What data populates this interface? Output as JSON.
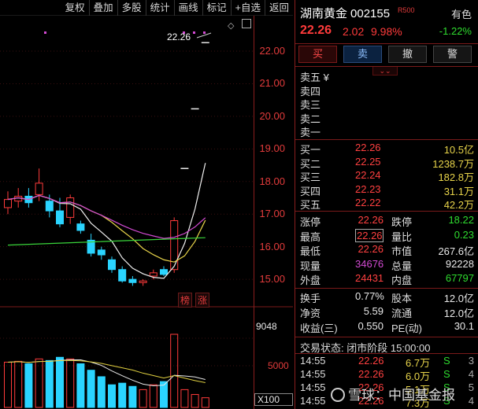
{
  "toolbar": {
    "items": [
      "复权",
      "叠加",
      "多股",
      "统计",
      "画线",
      "标记",
      "+自选",
      "返回"
    ]
  },
  "chart": {
    "price_axis": [
      "22.00",
      "21.00",
      "20.00",
      "19.00",
      "18.00",
      "17.00",
      "16.00",
      "15.00"
    ],
    "last_price_label": "22.26",
    "tag_bang": "榜",
    "tag_zhang": "涨",
    "volume_top": "9048",
    "volume_mid": "5000",
    "volume_unit": "X100"
  },
  "chart_data": {
    "type": "candlestick",
    "ylim": [
      14.4,
      22.7
    ],
    "candles": [
      {
        "o": 17.2,
        "c": 17.45,
        "h": 17.7,
        "l": 17.0
      },
      {
        "o": 17.4,
        "c": 17.55,
        "h": 17.8,
        "l": 17.2
      },
      {
        "o": 17.55,
        "c": 17.35,
        "h": 17.8,
        "l": 17.2
      },
      {
        "o": 17.6,
        "c": 17.95,
        "h": 18.4,
        "l": 17.4
      },
      {
        "o": 17.4,
        "c": 17.1,
        "h": 17.6,
        "l": 16.9
      },
      {
        "o": 17.1,
        "c": 16.7,
        "h": 17.5,
        "l": 16.6
      },
      {
        "o": 16.9,
        "c": 17.5,
        "h": 17.6,
        "l": 16.7
      },
      {
        "o": 16.7,
        "c": 16.5,
        "h": 16.8,
        "l": 16.4
      },
      {
        "o": 16.2,
        "c": 15.8,
        "h": 16.4,
        "l": 15.7
      },
      {
        "o": 15.9,
        "c": 15.75,
        "h": 16.0,
        "l": 15.6
      },
      {
        "o": 15.6,
        "c": 15.3,
        "h": 15.7,
        "l": 15.2
      },
      {
        "o": 15.3,
        "c": 14.95,
        "h": 15.4,
        "l": 14.9
      },
      {
        "o": 15.0,
        "c": 14.9,
        "h": 15.1,
        "l": 14.8
      },
      {
        "o": 14.9,
        "c": 14.95,
        "h": 15.0,
        "l": 14.8
      },
      {
        "o": 15.1,
        "c": 15.2,
        "h": 15.3,
        "l": 15.0
      },
      {
        "o": 15.3,
        "c": 15.15,
        "h": 15.4,
        "l": 15.1
      },
      {
        "o": 15.3,
        "c": 16.8,
        "h": 16.9,
        "l": 15.2
      },
      {
        "o": 18.4,
        "c": 18.4,
        "h": 18.4,
        "l": 18.4
      },
      {
        "o": 20.23,
        "c": 20.23,
        "h": 20.23,
        "l": 20.23
      },
      {
        "o": 22.26,
        "c": 22.26,
        "h": 22.26,
        "l": 22.26
      }
    ],
    "volumes": [
      5600,
      5700,
      5400,
      6000,
      5800,
      6200,
      6000,
      5400,
      4600,
      3800,
      2800,
      3000,
      2600,
      2200,
      2800,
      3200,
      9048,
      2200,
      1600,
      1200
    ]
  },
  "panel": {
    "name": "湖南黄金",
    "code": "002155",
    "r_tag": "R500",
    "sector": "有色",
    "price": "22.26",
    "change": "2.02",
    "pct": "9.98%",
    "sector_change": "-1.22%",
    "buttons": {
      "buy": "买",
      "sell": "卖",
      "cancel": "撤",
      "alert": "警"
    },
    "expander": "⌄⌄",
    "asks": [
      "卖五 ¥",
      "卖四",
      "卖三",
      "卖二",
      "卖一"
    ],
    "bids": [
      {
        "label": "买一",
        "price": "22.26",
        "vol": "10.5亿"
      },
      {
        "label": "买二",
        "price": "22.25",
        "vol": "1238.7万"
      },
      {
        "label": "买三",
        "price": "22.24",
        "vol": "182.8万"
      },
      {
        "label": "买四",
        "price": "22.23",
        "vol": "31.1万"
      },
      {
        "label": "买五",
        "price": "22.22",
        "vol": "42.2万"
      }
    ],
    "stats1": [
      {
        "l1": "涨停",
        "v1": "22.26",
        "c1": "red",
        "l2": "跌停",
        "v2": "18.22",
        "c2": "green"
      },
      {
        "l1": "最高",
        "v1": "22.26",
        "c1": "red",
        "l2": "量比",
        "v2": "0.23",
        "c2": "green"
      },
      {
        "l1": "最低",
        "v1": "22.26",
        "c1": "red",
        "l2": "市值",
        "v2": "267.6亿",
        "c2": "white"
      },
      {
        "l1": "现量",
        "v1": "34676",
        "c1": "purple",
        "l2": "总量",
        "v2": "92228",
        "c2": "white"
      },
      {
        "l1": "外盘",
        "v1": "24431",
        "c1": "red",
        "l2": "内盘",
        "v2": "67797",
        "c2": "green"
      }
    ],
    "stats2": [
      {
        "l1": "换手",
        "v1": "0.77%",
        "l2": "股本",
        "v2": "12.0亿"
      },
      {
        "l1": "净资",
        "v1": "5.59",
        "l2": "流通",
        "v2": "12.0亿"
      },
      {
        "l1": "收益(三)",
        "v1": "0.550",
        "l2": "PE(动)",
        "v2": "30.1"
      }
    ],
    "trade_status": "交易状态: 闭市阶段 15:00:00",
    "ticks": [
      {
        "t": "14:55",
        "p": "22.26",
        "v": "6.7万",
        "s": "S",
        "n": "3"
      },
      {
        "t": "14:55",
        "p": "22.26",
        "v": "6.0万",
        "s": "S",
        "n": "4"
      },
      {
        "t": "14:55",
        "p": "22.26",
        "v": "5.1万",
        "s": "S",
        "n": "5"
      },
      {
        "t": "14:55",
        "p": "22.26",
        "v": "7.3万",
        "s": "S",
        "n": "4"
      }
    ]
  },
  "watermark": "雪球：中国基金报"
}
